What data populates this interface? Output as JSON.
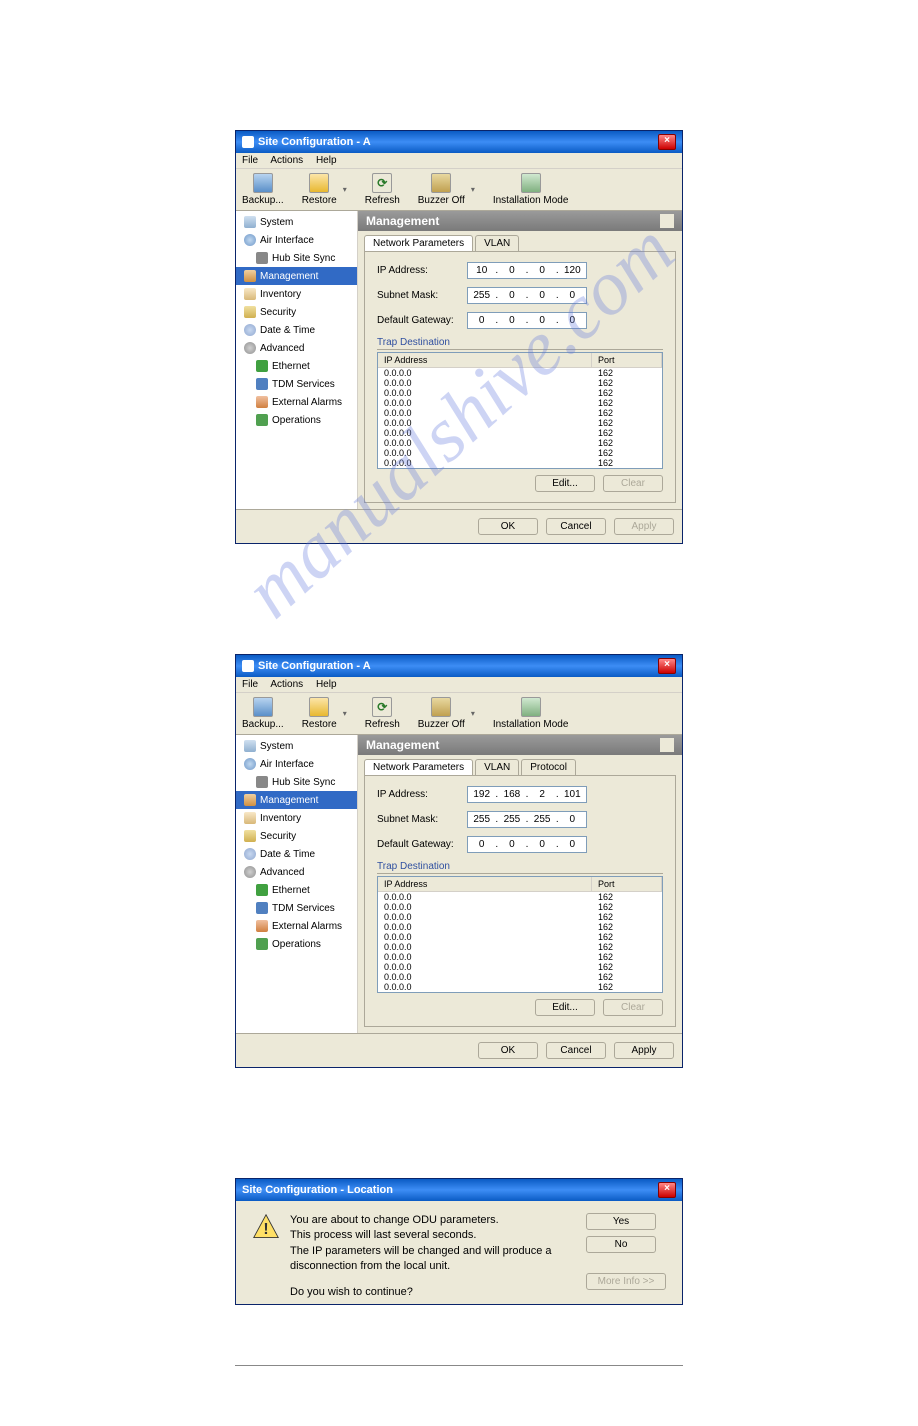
{
  "window1": {
    "title": "Site Configuration - A",
    "menu": [
      "File",
      "Actions",
      "Help"
    ],
    "toolbar": {
      "backup": "Backup...",
      "restore": "Restore",
      "refresh": "Refresh",
      "buzzer": "Buzzer Off",
      "install": "Installation Mode"
    },
    "sidebar": {
      "system": "System",
      "air": "Air Interface",
      "hub": "Hub Site Sync",
      "mgmt": "Management",
      "inv": "Inventory",
      "sec": "Security",
      "date": "Date & Time",
      "adv": "Advanced",
      "eth": "Ethernet",
      "tdm": "TDM Services",
      "ext": "External Alarms",
      "ops": "Operations"
    },
    "header": "Management",
    "tabs": {
      "net": "Network Parameters",
      "vlan": "VLAN"
    },
    "fields": {
      "ip_lbl": "IP Address:",
      "ip": [
        "10",
        "0",
        "0",
        "120"
      ],
      "mask_lbl": "Subnet Mask:",
      "mask": [
        "255",
        "0",
        "0",
        "0"
      ],
      "gw_lbl": "Default Gateway:",
      "gw": [
        "0",
        "0",
        "0",
        "0"
      ]
    },
    "trap_lbl": "Trap Destination",
    "trap_cols": {
      "ip": "IP Address",
      "port": "Port"
    },
    "traps": [
      {
        "ip": "0.0.0.0",
        "port": "162"
      },
      {
        "ip": "0.0.0.0",
        "port": "162"
      },
      {
        "ip": "0.0.0.0",
        "port": "162"
      },
      {
        "ip": "0.0.0.0",
        "port": "162"
      },
      {
        "ip": "0.0.0.0",
        "port": "162"
      },
      {
        "ip": "0.0.0.0",
        "port": "162"
      },
      {
        "ip": "0.0.0.0",
        "port": "162"
      },
      {
        "ip": "0.0.0.0",
        "port": "162"
      },
      {
        "ip": "0.0.0.0",
        "port": "162"
      },
      {
        "ip": "0.0.0.0",
        "port": "162"
      }
    ],
    "btns": {
      "edit": "Edit...",
      "clear": "Clear",
      "ok": "OK",
      "cancel": "Cancel",
      "apply": "Apply"
    }
  },
  "window2": {
    "title": "Site Configuration - A",
    "menu": [
      "File",
      "Actions",
      "Help"
    ],
    "toolbar": {
      "backup": "Backup...",
      "restore": "Restore",
      "refresh": "Refresh",
      "buzzer": "Buzzer Off",
      "install": "Installation Mode"
    },
    "sidebar": {
      "system": "System",
      "air": "Air Interface",
      "hub": "Hub Site Sync",
      "mgmt": "Management",
      "inv": "Inventory",
      "sec": "Security",
      "date": "Date & Time",
      "adv": "Advanced",
      "eth": "Ethernet",
      "tdm": "TDM Services",
      "ext": "External Alarms",
      "ops": "Operations"
    },
    "header": "Management",
    "tabs": {
      "net": "Network Parameters",
      "vlan": "VLAN",
      "proto": "Protocol"
    },
    "fields": {
      "ip_lbl": "IP Address:",
      "ip": [
        "192",
        "168",
        "2",
        "101"
      ],
      "mask_lbl": "Subnet Mask:",
      "mask": [
        "255",
        "255",
        "255",
        "0"
      ],
      "gw_lbl": "Default Gateway:",
      "gw": [
        "0",
        "0",
        "0",
        "0"
      ]
    },
    "trap_lbl": "Trap Destination",
    "trap_cols": {
      "ip": "IP Address",
      "port": "Port"
    },
    "traps": [
      {
        "ip": "0.0.0.0",
        "port": "162"
      },
      {
        "ip": "0.0.0.0",
        "port": "162"
      },
      {
        "ip": "0.0.0.0",
        "port": "162"
      },
      {
        "ip": "0.0.0.0",
        "port": "162"
      },
      {
        "ip": "0.0.0.0",
        "port": "162"
      },
      {
        "ip": "0.0.0.0",
        "port": "162"
      },
      {
        "ip": "0.0.0.0",
        "port": "162"
      },
      {
        "ip": "0.0.0.0",
        "port": "162"
      },
      {
        "ip": "0.0.0.0",
        "port": "162"
      },
      {
        "ip": "0.0.0.0",
        "port": "162"
      }
    ],
    "btns": {
      "edit": "Edit...",
      "clear": "Clear",
      "ok": "OK",
      "cancel": "Cancel",
      "apply": "Apply"
    }
  },
  "dialog": {
    "title": "Site Configuration - Location",
    "line1": "You are about to change ODU parameters.",
    "line2": "This process will last several seconds.",
    "line3": "The IP parameters will be changed and will produce a disconnection from the local unit.",
    "line4": "Do you wish to continue?",
    "yes": "Yes",
    "no": "No",
    "more": "More Info >>"
  },
  "watermark": "manualshive.com"
}
